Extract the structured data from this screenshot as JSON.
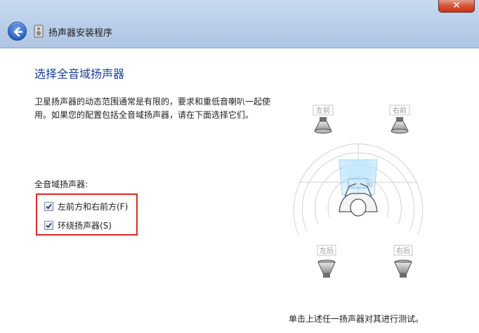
{
  "window": {
    "title": "扬声器安装程序",
    "close_label": "✕"
  },
  "page": {
    "heading": "选择全音域扬声器",
    "description": "卫星扬声器的动态范围通常是有限的，要求和重低音喇叭一起使用。如果您的配置包括全音域扬声器，请在下面选择它们。",
    "group_label": "全音域扬声器:",
    "options": [
      {
        "label": "左前方和右前方(F)",
        "checked": true
      },
      {
        "label": "环绕扬声器(S)",
        "checked": true
      }
    ]
  },
  "diagram": {
    "speakers": [
      {
        "label": "左前"
      },
      {
        "label": "右前"
      },
      {
        "label": "左后"
      },
      {
        "label": "右后"
      }
    ]
  },
  "footer": {
    "hint": "单击上述任一扬声器对其进行测试。"
  },
  "colors": {
    "heading": "#1c3f94",
    "highlight": "#d62b2b",
    "titlebar": "#b7cde8"
  }
}
